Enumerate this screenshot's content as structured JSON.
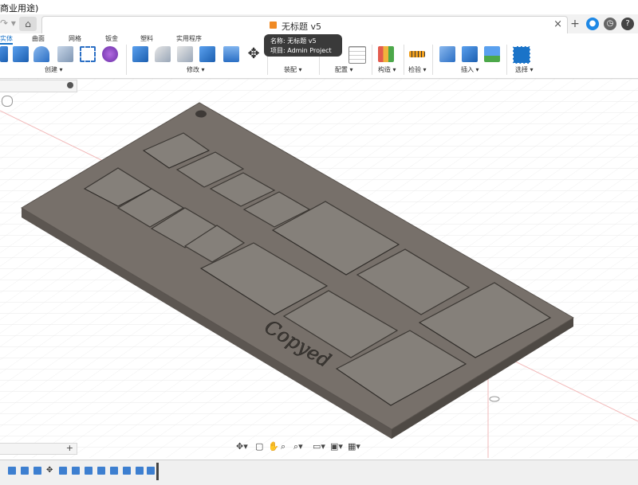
{
  "app": {
    "title": "商业用途)"
  },
  "tabs": {
    "document_label": "无标题 v5",
    "close_label": "×",
    "plus_label": "+"
  },
  "ribbon": {
    "tabs": [
      "实体",
      "曲面",
      "网格",
      "钣金",
      "塑料",
      "实用程序"
    ],
    "active_tab": "实体",
    "groups": {
      "create": "创建 ▾",
      "modify": "修改 ▾",
      "assemble": "装配 ▾",
      "configure": "配置 ▾",
      "construct": "构造 ▾",
      "inspect": "检验 ▾",
      "insert": "插入 ▾",
      "select": "选择 ▾"
    }
  },
  "tooltip": {
    "name_line": "名称: 无标题 v5",
    "project_line": "项目: Admin Project"
  },
  "model": {
    "engraved_text": "Copyed"
  },
  "colors": {
    "accent": "#1a73c8",
    "plate_top": "#77706a",
    "plate_side": "#5c5651"
  },
  "icons": {
    "nav_orbit": "orbit-icon",
    "nav_pan": "hand-icon",
    "nav_zoom": "zoom-icon",
    "display": "display-icon",
    "grid": "grid-icon"
  }
}
